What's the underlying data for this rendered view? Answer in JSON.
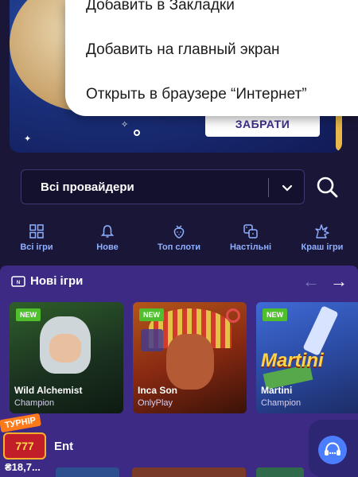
{
  "context_menu": {
    "items": [
      "Добавить в Закладки",
      "Добавить на главный экран",
      "Открыть в браузере “Интернет”"
    ]
  },
  "banner": {
    "cta_label": "ЗАБРАТИ"
  },
  "provider_filter": {
    "selected": "Всі провайдери"
  },
  "categories": [
    {
      "label": "Всі ігри",
      "icon": "grid-icon"
    },
    {
      "label": "Нове",
      "icon": "bell-icon"
    },
    {
      "label": "Топ слоти",
      "icon": "strawberry-icon"
    },
    {
      "label": "Настільні",
      "icon": "dice-icon"
    },
    {
      "label": "Краш ігри",
      "icon": "explosion-icon"
    }
  ],
  "new_games": {
    "title": "Нові ігри",
    "games": [
      {
        "badge": "NEW",
        "name": "Wild Alchemist",
        "provider": "Champion"
      },
      {
        "badge": "NEW",
        "name": "Inca Son",
        "provider": "OnlyPlay"
      },
      {
        "badge": "NEW",
        "name": "Martini",
        "provider": "Champion"
      }
    ]
  },
  "next_section": {
    "title": "Ent"
  },
  "tournament": {
    "badge": "ТУРНІР",
    "reels": "777",
    "amount": "₴18,7..."
  },
  "colors": {
    "background": "#1a1638",
    "section": "#3c2a85",
    "accent_blue": "#8fb0ff",
    "new_badge": "#4fbf2e"
  }
}
